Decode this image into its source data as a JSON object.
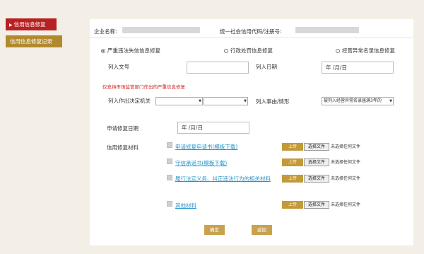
{
  "sidebar": {
    "items": [
      {
        "label": "信用信息修复",
        "active": true
      },
      {
        "label": "信用信息修复记录",
        "active": false
      }
    ]
  },
  "form": {
    "company_label": "企业名称:",
    "credit_code_label": "统一社会信用代码/注册号:",
    "repair_types": [
      {
        "label": "严重违法失信信息修复",
        "selected": true
      },
      {
        "label": "行政处罚信息修复",
        "selected": false
      },
      {
        "label": "经营异常名录信息修复",
        "selected": false
      }
    ],
    "doc_number_label": "列入文号",
    "doc_number_value": "",
    "list_date_label": "列入日期",
    "list_date_value": "年 /月/日",
    "notice": "仅支持市场监管部门作出的严重信息修复",
    "authority_label": "列入作出决定机关",
    "authority_select_1": "",
    "authority_select_2": "",
    "reason_label": "列入事由/情形",
    "reason_value": "被列入经营异常名录届满3年的",
    "apply_date_label": "申请修复日期",
    "apply_date_value": "年 /月/日",
    "materials_label": "信用修复材料",
    "materials": [
      {
        "label": "申请修复申请书(模板下载)",
        "upload": "上传",
        "choose": "选择文件",
        "status": "未选择任何文件"
      },
      {
        "label": "守信承诺书(模板下载)",
        "upload": "上传",
        "choose": "选择文件",
        "status": "未选择任何文件"
      },
      {
        "label": "履行法定义务、纠正违法行为的相关材料",
        "upload": "上传",
        "choose": "选择文件",
        "status": "未选择任何文件"
      },
      {
        "label": "其他材料",
        "upload": "上传",
        "choose": "选择文件",
        "status": "未选择任何文件"
      }
    ],
    "confirm_label": "确定",
    "back_label": "返回"
  },
  "colors": {
    "active_tab": "#b72124",
    "gold": "#b28a2e",
    "notice_red": "#d21f1f",
    "link_blue": "#2a95c8"
  }
}
